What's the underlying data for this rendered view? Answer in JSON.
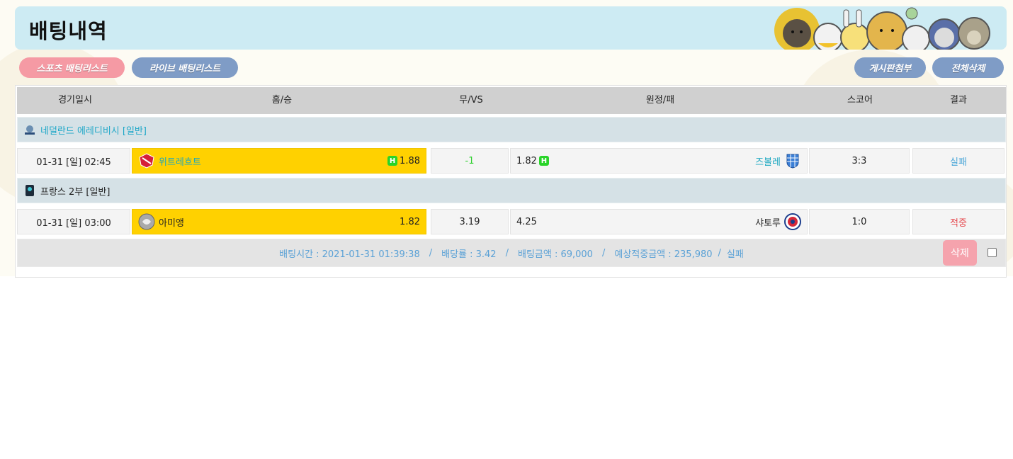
{
  "page": {
    "title": "배팅내역"
  },
  "nav": {
    "sports_list": "스포츠 배팅리스트",
    "live_list": "라이브 배팅리스트",
    "attach_board": "게시판첨부",
    "delete_all": "전체삭제"
  },
  "table": {
    "headers": [
      "경기일시",
      "홈/승",
      "무/VS",
      "원정/패",
      "스코어",
      "결과"
    ]
  },
  "bets": [
    {
      "league": "네덜란드 에레디비시 [일반]",
      "league_color": "#1fa8c8",
      "date": "01-31 [일] 02:45",
      "home_team": "위트레흐트",
      "home_team_color": "#1aa7c0",
      "home_odds": "1.88",
      "draw": "-1",
      "draw_color": "#2fd02f",
      "away_odds": "1.82",
      "away_team": "즈볼레",
      "away_team_color": "#1aa7c0",
      "score": "3:3",
      "result": "실패",
      "result_color": "#4aa6d8",
      "home_handicap_icon": "H",
      "away_handicap_icon": "H"
    },
    {
      "league": "프랑스 2부 [일반]",
      "league_color": "#222222",
      "date": "01-31 [일] 03:00",
      "home_team": "아미앵",
      "home_team_color": "#222222",
      "home_odds": "1.82",
      "draw": "3.19",
      "draw_color": "#222222",
      "away_odds": "4.25",
      "away_team": "샤토루",
      "away_team_color": "#222222",
      "score": "1:0",
      "result": "적중",
      "result_color": "#e6484e"
    }
  ],
  "summary": {
    "bet_time": "배팅시간 : 2021-01-31 01:39:38",
    "odds_rate": "배당률 : 3.42",
    "bet_amount": "배팅금액 : 69,000",
    "expected_win": "예상적중금액 : 235,980",
    "separator": "/",
    "status": "실패",
    "delete_label": "삭제"
  },
  "colors": {
    "title_bar": "#cdebf3",
    "pink_button": "#f59aa4",
    "blue_button": "#7f9cc6",
    "home_highlight": "#ffd100",
    "league_row": "#d5e1e6",
    "header_row": "#d0d0d0",
    "summary_text": "#5aa1d6"
  }
}
